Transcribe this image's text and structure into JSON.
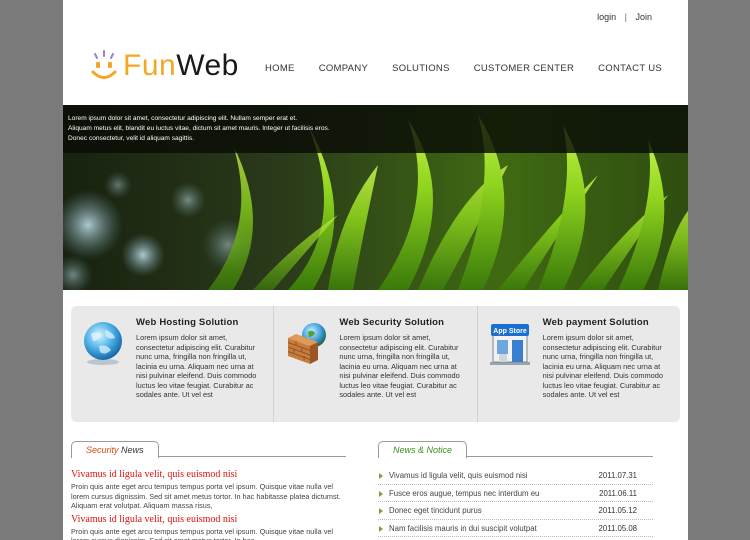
{
  "header": {
    "links": {
      "login": "login",
      "separator": "|",
      "join": "Join"
    },
    "logo": {
      "fun": "Fun",
      "web": "Web"
    },
    "nav": [
      "HOME",
      "COMPANY",
      "SOLUTIONS",
      "CUSTOMER CENTER",
      "CONTACT US"
    ]
  },
  "hero": {
    "caption": [
      "Lorem ipsum dolor sit amet, consectetur adipiscing elit. Nullam semper erat et.",
      "Aliquam metus elit, blandit eu luctus vitae, dictum sit amet mauris. Integer ut facilisis eros.",
      "Donec consectetur, velit id aliquam sagittis."
    ]
  },
  "services": [
    {
      "title": "Web Hosting Solution",
      "icon": "globe-icon",
      "text": "Lorem ipsum dolor sit amet, consectetur adipiscing elit. Curabitur nunc urna, fringilla non fringilla ut, lacinia eu urna. Aliquam nec urna at nisi pulvinar eleifend. Duis commodo luctus leo vitae feugiat. Curabitur ac sodales ante. Ut vel est"
    },
    {
      "title": "Web Security Solution",
      "icon": "firewall-icon",
      "text": "Lorem ipsum dolor sit amet, consectetur adipiscing elit. Curabitur nunc urna, fringilla non fringilla ut, lacinia eu urna. Aliquam nec urna at nisi pulvinar eleifend. Duis commodo luctus leo vitae feugiat. Curabitur ac sodales ante. Ut vel est"
    },
    {
      "title": "Web payment Solution",
      "icon": "app-store-icon",
      "icon_label": "App Store",
      "text": "Lorem ipsum dolor sit amet, consectetur adipiscing elit. Curabitur nunc urna, fringilla non fringilla ut, lacinia eu urna. Aliquam nec urna at nisi pulvinar eleifend. Duis commodo luctus leo vitae feugiat. Curabitur ac sodales ante. Ut vel est"
    }
  ],
  "security_news": {
    "tab_highlight": "Security",
    "tab_rest": " News",
    "items": [
      {
        "title": "Vivamus id ligula velit, quis euismod nisi",
        "text": "Proin quis ante eget arcu tempus tempus porta vel ipsum. Quisque vitae nulla vel lorem cursus dignissim. Sed sit amet metus tortor. In hac habitasse platea dictumst. Aliquam erat volutpat. Aliquam massa risus,"
      },
      {
        "title": "Vivamus id ligula velit, quis euismod nisi",
        "text": "Proin quis ante eget arcu tempus tempus porta vel ipsum. Quisque vitae nulla vel lorem cursus dignissim. Sed sit amet metus tortor. In hac"
      }
    ]
  },
  "news_notice": {
    "tab_label": "News & Notice",
    "items": [
      {
        "title": "Vivamus id ligula velit, quis euismod nisi",
        "date": "2011.07.31"
      },
      {
        "title": "Fusce eros augue, tempus nec interdum eu",
        "date": "2011.06.11"
      },
      {
        "title": "Donec eget tincidunt purus",
        "date": "2011.05.12"
      },
      {
        "title": "Nam facilisis mauris in dui suscipit volutpat",
        "date": "2011.05.08"
      }
    ]
  },
  "colors": {
    "background": "#7a7a7a",
    "logo_accent": "#f5a623",
    "news_title_red": "#e01010",
    "notice_arrow": "#8a9a3b"
  }
}
